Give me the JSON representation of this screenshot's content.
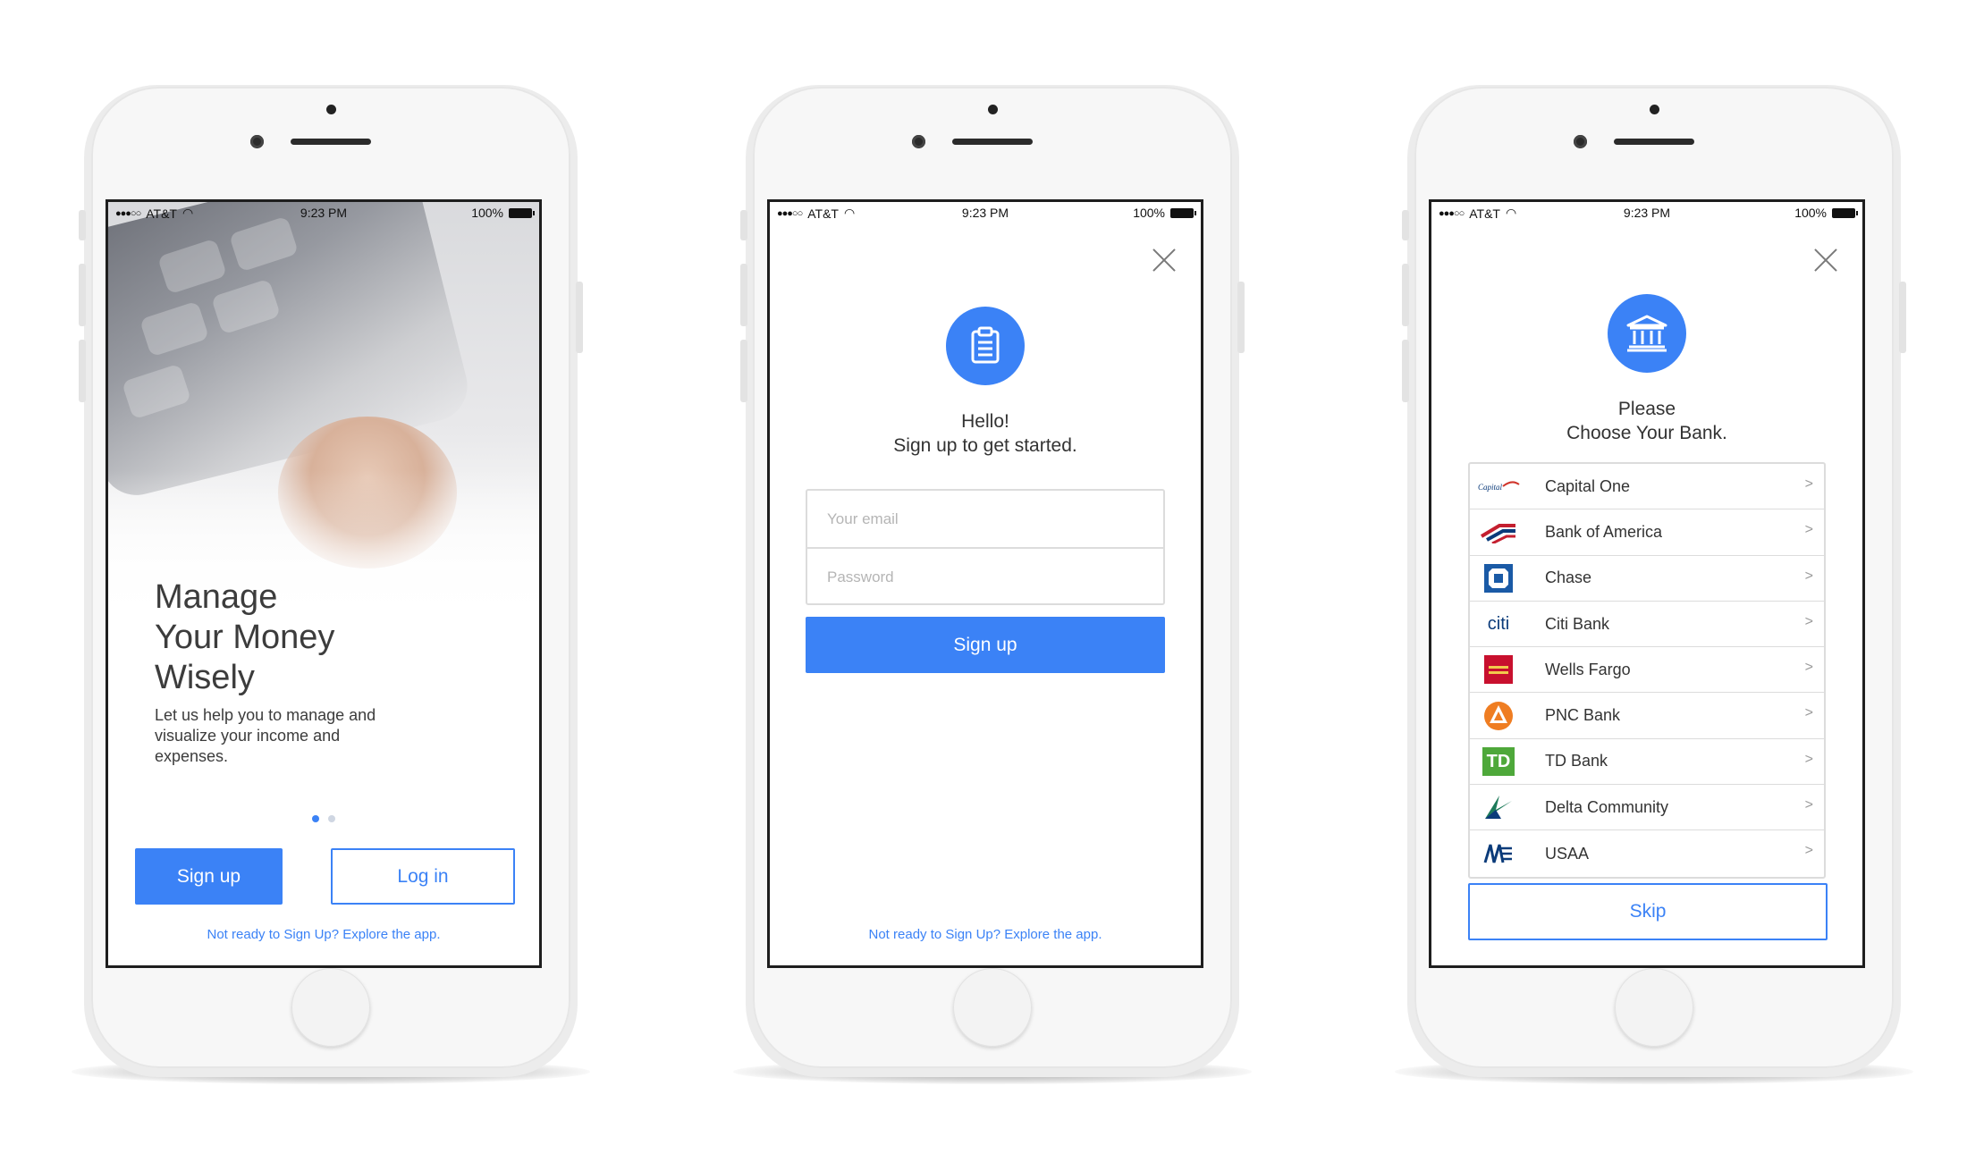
{
  "status": {
    "carrier": "AT&T",
    "time": "9:23 PM",
    "battery": "100%",
    "signal": "●●●○○"
  },
  "screen1": {
    "headline_l1": "Manage",
    "headline_l2": "Your Money",
    "headline_l3": "Wisely",
    "description": "Let us  help you to manage and visualize your income and expenses.",
    "signup_label": "Sign up",
    "login_label": "Log in",
    "explore_link": "Not ready to Sign Up? Explore the app.",
    "pager": {
      "pages": 2,
      "active": 1
    }
  },
  "screen2": {
    "greeting_l1": "Hello!",
    "greeting_l2": "Sign up to get started.",
    "email_placeholder": "Your email",
    "password_placeholder": "Password",
    "signup_label": "Sign up",
    "explore_link": "Not ready to Sign Up? Explore the app."
  },
  "screen3": {
    "title_l1": "Please",
    "title_l2": "Choose Your Bank.",
    "banks": [
      {
        "name": "Capital One",
        "chevron": ">"
      },
      {
        "name": "Bank of America",
        "chevron": ">"
      },
      {
        "name": "Chase",
        "chevron": ">"
      },
      {
        "name": "Citi Bank",
        "chevron": ">",
        "logo_text": "citi"
      },
      {
        "name": "Wells Fargo",
        "chevron": ">"
      },
      {
        "name": "PNC Bank",
        "chevron": ">"
      },
      {
        "name": "TD Bank",
        "chevron": ">",
        "logo_text": "TD"
      },
      {
        "name": "Delta Community",
        "chevron": ">"
      },
      {
        "name": "USAA",
        "chevron": ">"
      }
    ],
    "skip_label": "Skip"
  },
  "colors": {
    "accent": "#3b82f6",
    "border": "#dcdcdc",
    "text": "#333333",
    "phone_body": "#f7f7f7"
  }
}
